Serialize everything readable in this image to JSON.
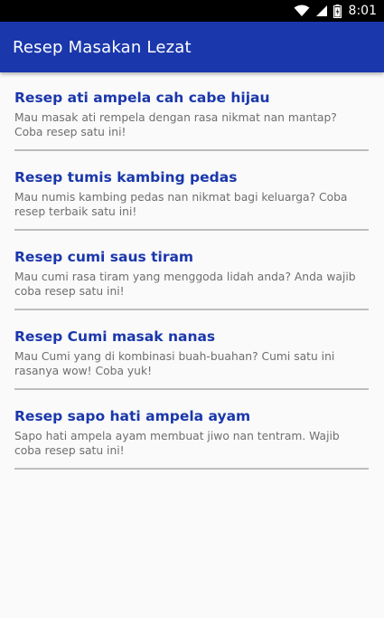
{
  "status_bar": {
    "time": "8:01",
    "icons": [
      "wifi-icon",
      "signal-icon",
      "battery-icon"
    ]
  },
  "app_bar": {
    "title": "Resep Masakan Lezat",
    "color": "#1a37ac"
  },
  "recipes": [
    {
      "title": "Resep ati ampela cah cabe hijau",
      "description": "Mau masak ati rempela dengan rasa nikmat nan mantap? Coba resep satu ini!"
    },
    {
      "title": "Resep tumis kambing pedas",
      "description": "Mau numis kambing pedas nan nikmat bagi keluarga? Coba resep terbaik satu ini!"
    },
    {
      "title": "Resep cumi saus tiram",
      "description": "Mau cumi rasa tiram yang menggoda lidah anda? Anda wajib coba resep satu ini!"
    },
    {
      "title": "Resep Cumi masak nanas",
      "description": "Mau Cumi yang di kombinasi buah-buahan? Cumi satu ini rasanya wow! Coba yuk!"
    },
    {
      "title": "Resep sapo hati ampela ayam",
      "description": "Sapo hati ampela ayam membuat jiwo nan tentram. Wajib coba resep satu ini!"
    }
  ]
}
